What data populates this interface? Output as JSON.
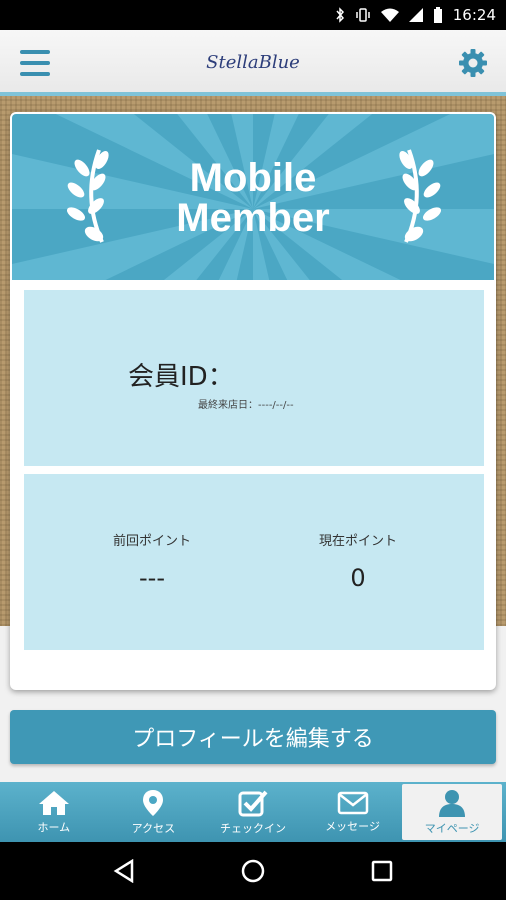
{
  "status_bar": {
    "time": "16:24"
  },
  "header": {
    "brand": "StellaBlue"
  },
  "card": {
    "banner_line1": "Mobile",
    "banner_line2": "Member",
    "member_id_label": "会員ID：",
    "last_visit": "最終来店日：----/--/--",
    "previous_points_label": "前回ポイント",
    "previous_points_value": "---",
    "current_points_label": "現在ポイント",
    "current_points_value": "0"
  },
  "edit_button": {
    "label": "プロフィールを編集する"
  },
  "tabs": [
    {
      "label": "ホーム",
      "icon": "home-icon"
    },
    {
      "label": "アクセス",
      "icon": "map-pin-icon"
    },
    {
      "label": "チェックイン",
      "icon": "checkbox-icon"
    },
    {
      "label": "メッセージ",
      "icon": "mail-icon"
    },
    {
      "label": "マイページ",
      "icon": "person-icon",
      "active": true
    }
  ],
  "colors": {
    "accent": "#3f98b6",
    "panel": "#c6e8f2",
    "banner": "#4ba7c4"
  }
}
